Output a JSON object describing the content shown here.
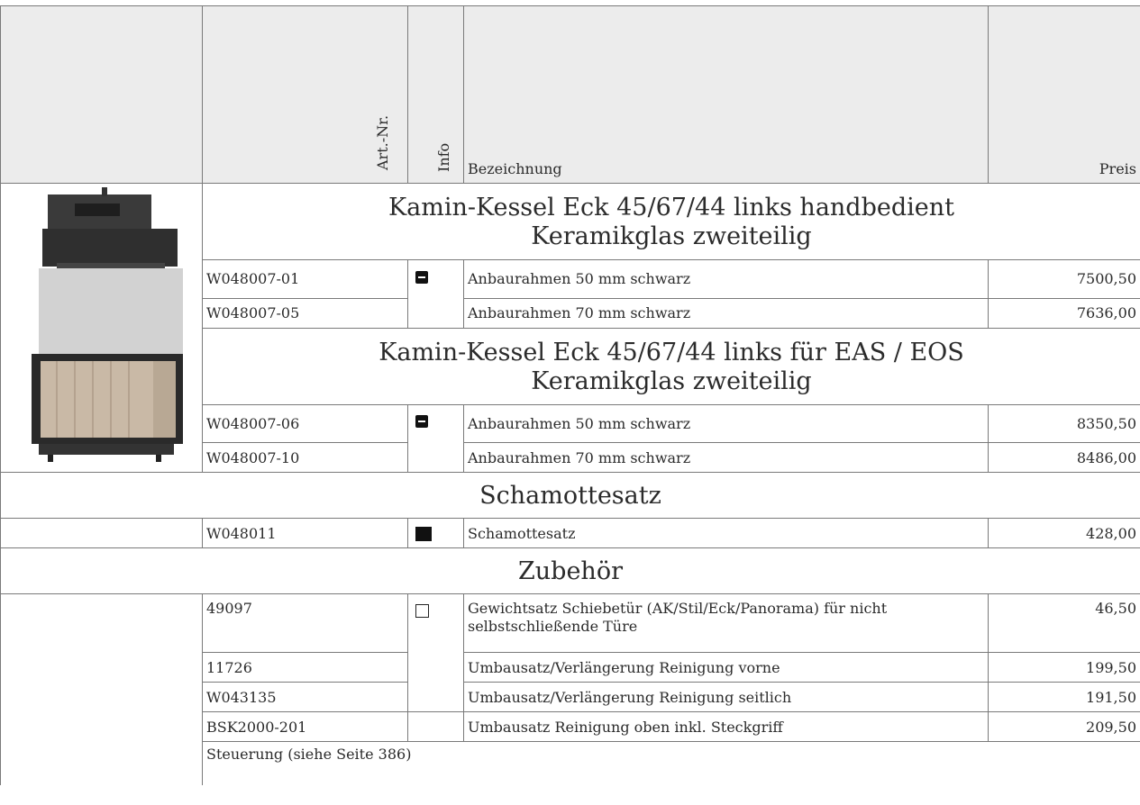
{
  "header": {
    "art_nr": "Art.-Nr.",
    "info": "Info",
    "bezeichnung": "Bezeichnung",
    "preis": "Preis"
  },
  "groups": [
    {
      "title_line1": "Kamin-Kessel Eck 45/67/44 links handbedient",
      "title_line2": "Keramikglas zweiteilig",
      "rows": [
        {
          "art": "W048007-01",
          "desc": "Anbaurahmen 50 mm schwarz",
          "price": "7500,50"
        },
        {
          "art": "W048007-05",
          "desc": "Anbaurahmen 70 mm schwarz",
          "price": "7636,00"
        }
      ]
    },
    {
      "title_line1": "Kamin-Kessel Eck 45/67/44 links für EAS / EOS",
      "title_line2": "Keramikglas zweiteilig",
      "rows": [
        {
          "art": "W048007-06",
          "desc": "Anbaurahmen 50 mm schwarz",
          "price": "8350,50"
        },
        {
          "art": "W048007-10",
          "desc": "Anbaurahmen 70 mm schwarz",
          "price": "8486,00"
        }
      ]
    }
  ],
  "schamotte": {
    "title": "Schamottesatz",
    "row": {
      "art": "W048011",
      "desc": "Schamottesatz",
      "price": "428,00"
    }
  },
  "zubehoer": {
    "title": "Zubehör",
    "rows": [
      {
        "art": "49097",
        "desc": "Gewichtsatz Schiebetür (AK/Stil/Eck/Panorama) für nicht selbstschließende Türe",
        "price": "46,50"
      },
      {
        "art": "11726",
        "desc": "Umbausatz/Verlängerung Reinigung vorne",
        "price": "199,50"
      },
      {
        "art": "W043135",
        "desc": "Umbausatz/Verlängerung Reinigung seitlich",
        "price": "191,50"
      },
      {
        "art": "BSK2000-201",
        "desc": "Umbausatz Reinigung oben inkl. Steckgriff",
        "price": "209,50"
      }
    ],
    "note": "Steuerung (siehe Seite 386)"
  },
  "icons": {
    "minus": "minus-square-icon",
    "full": "filled-square-icon",
    "empty": "empty-square-icon"
  },
  "colors": {
    "header_bg": "#ececec",
    "border": "#7a7a7a"
  }
}
